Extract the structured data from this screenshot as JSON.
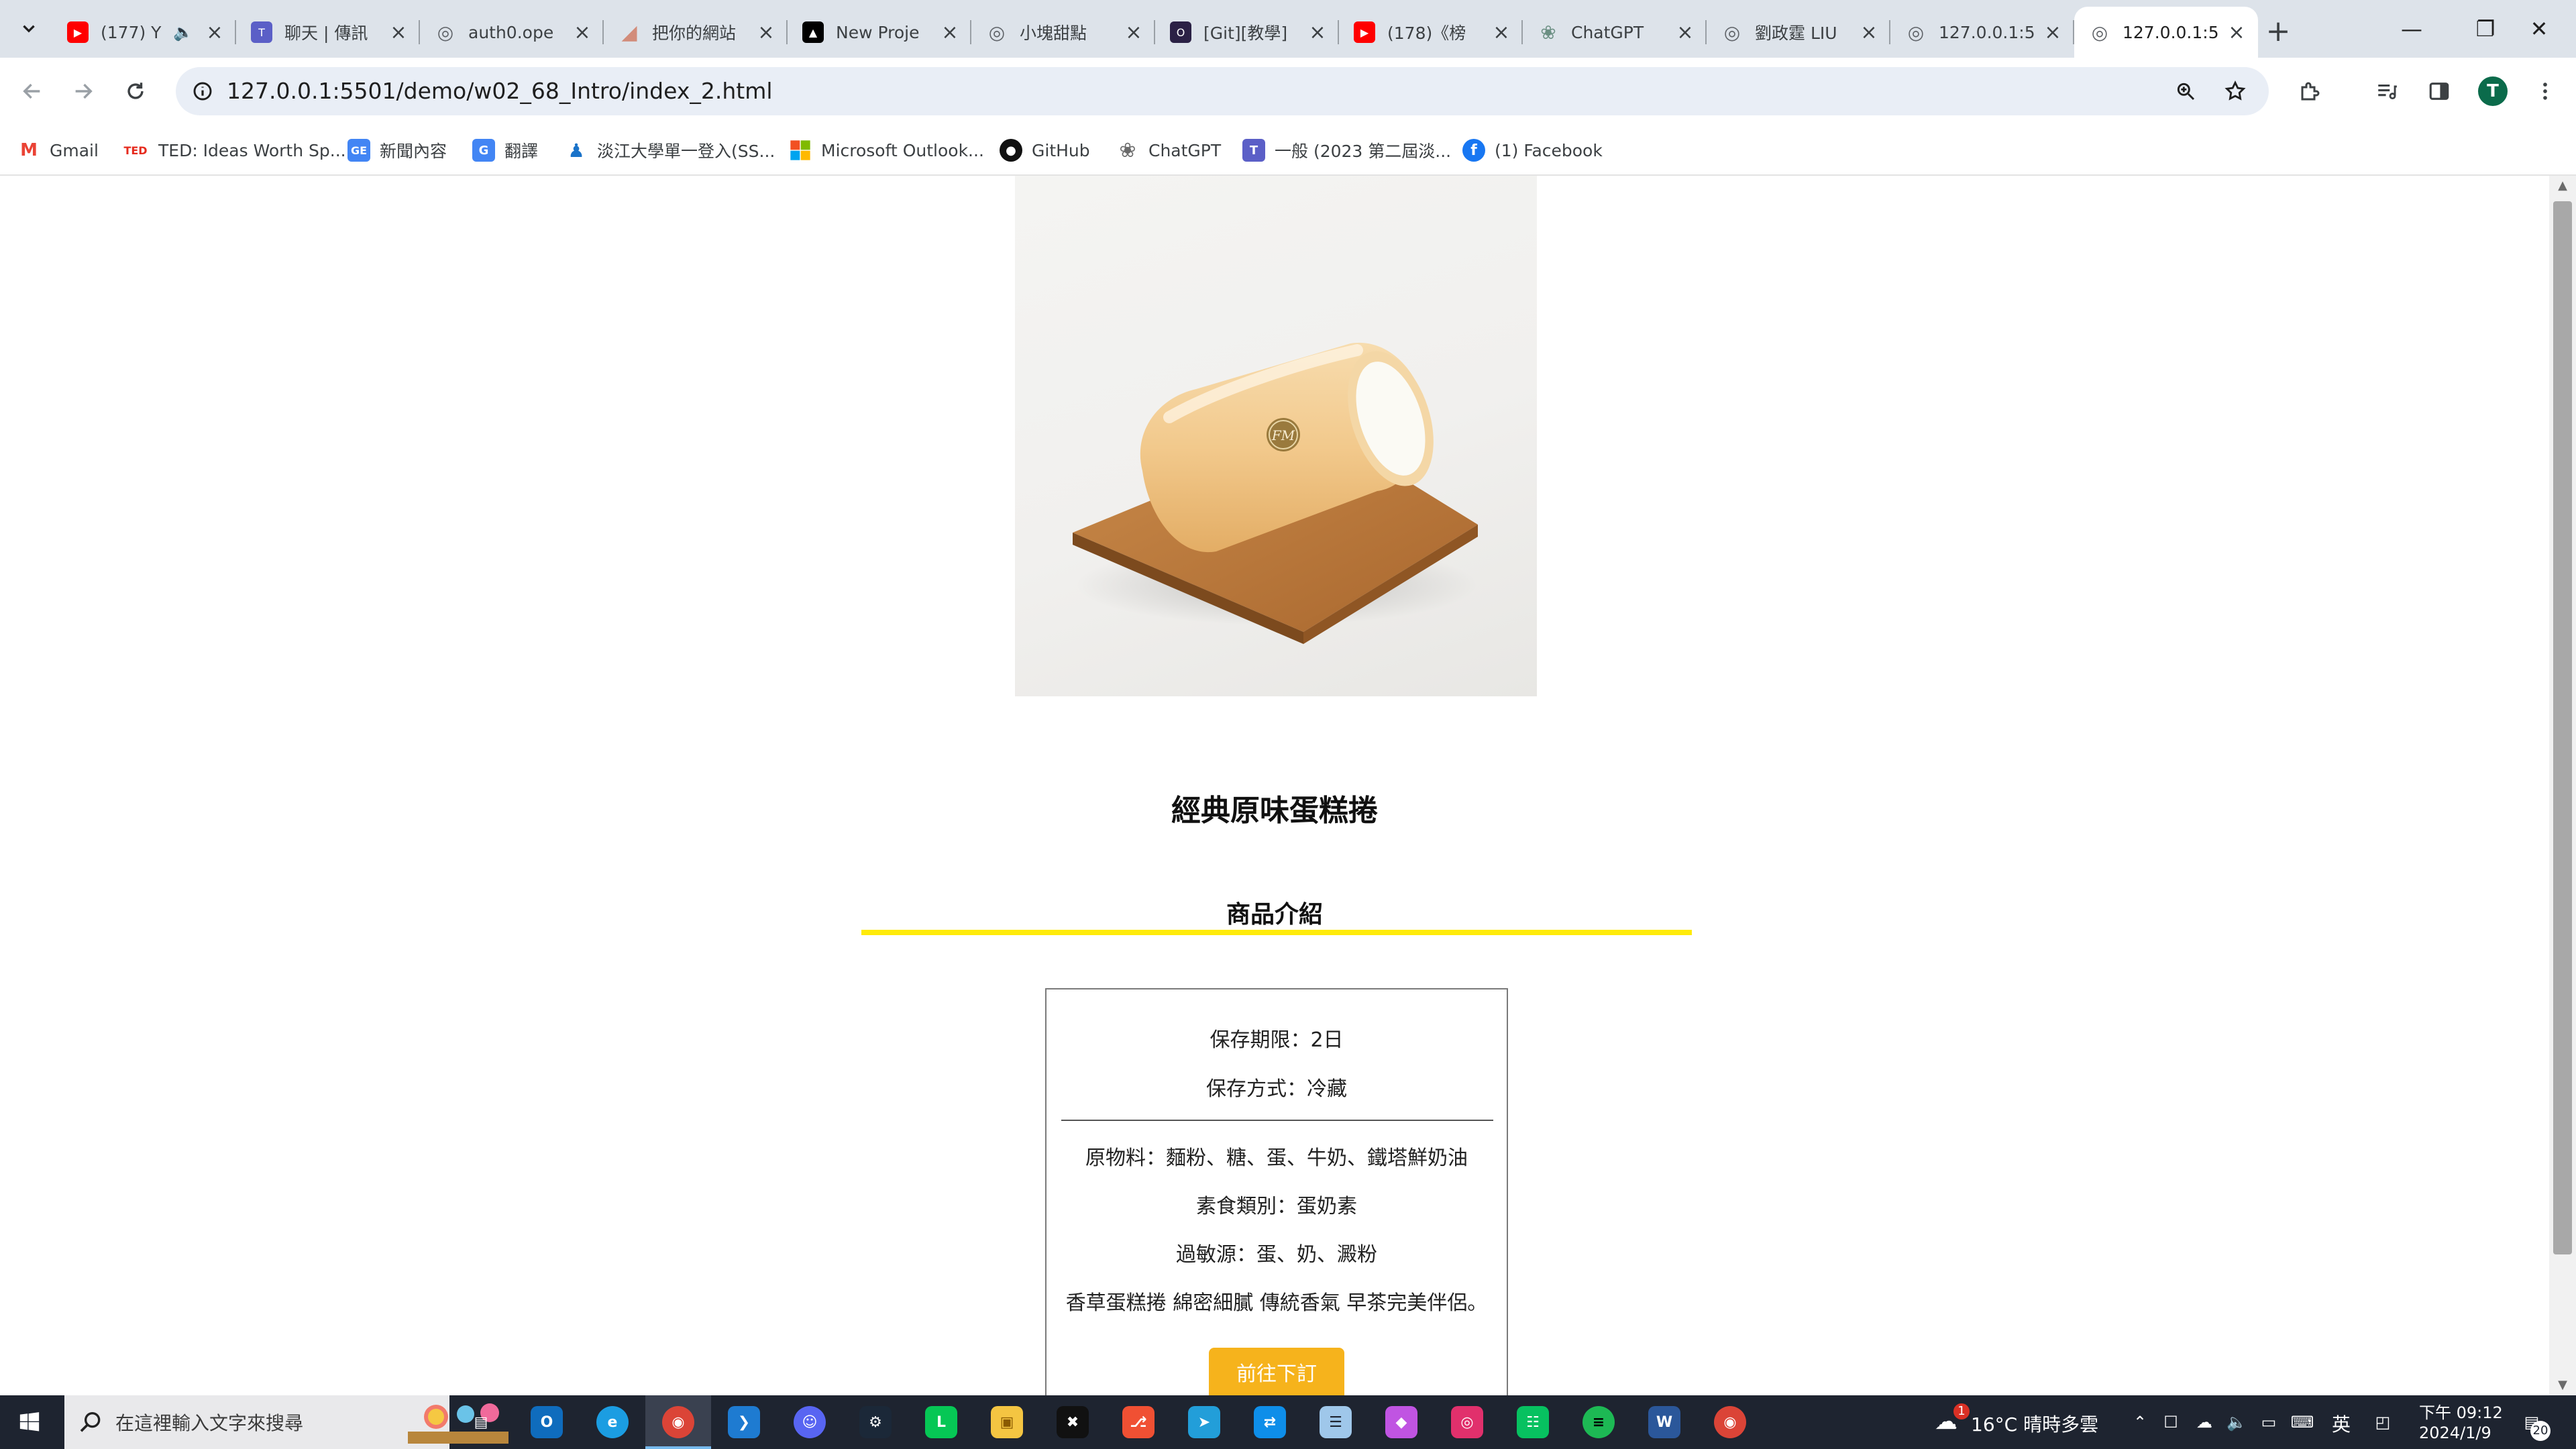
{
  "tabs": [
    {
      "title": "(177) Y",
      "favicon": "youtube-icon",
      "muted_icon": "speaker-icon"
    },
    {
      "title": "聊天 | 傳訊",
      "favicon": "teams-icon"
    },
    {
      "title": "auth0.ope",
      "favicon": "globe-icon"
    },
    {
      "title": "把你的網站",
      "favicon": "triangle-icon"
    },
    {
      "title": "New Proje",
      "favicon": "vercel-icon"
    },
    {
      "title": "小塊甜點",
      "favicon": "globe-icon"
    },
    {
      "title": "[Git][教學]",
      "favicon": "blog-icon"
    },
    {
      "title": "(178)《榜",
      "favicon": "youtube-icon"
    },
    {
      "title": "ChatGPT",
      "favicon": "openai-icon"
    },
    {
      "title": "劉政霆 LIU",
      "favicon": "globe-icon"
    },
    {
      "title": "127.0.0.1:5",
      "favicon": "globe-icon"
    },
    {
      "title": "127.0.0.1:5",
      "favicon": "globe-icon",
      "active": true
    }
  ],
  "toolbar": {
    "url": "127.0.0.1:5501/demo/w02_68_Intro/index_2.html",
    "profile_initial": "T"
  },
  "bookmarks": [
    {
      "label": "Gmail",
      "icon": "gmail-icon"
    },
    {
      "label": "TED: Ideas Worth Sp...",
      "icon": "ted-icon"
    },
    {
      "label": "新聞內容",
      "icon": "news-icon"
    },
    {
      "label": "翻譯",
      "icon": "translate-icon"
    },
    {
      "label": "淡江大學單一登入(SS...",
      "icon": "tku-icon"
    },
    {
      "label": "Microsoft Outlook...",
      "icon": "microsoft-icon"
    },
    {
      "label": "GitHub",
      "icon": "github-icon"
    },
    {
      "label": "ChatGPT",
      "icon": "openai-icon"
    },
    {
      "label": "一般 (2023 第二屆淡...",
      "icon": "teams-icon"
    },
    {
      "label": "(1) Facebook",
      "icon": "facebook-icon"
    }
  ],
  "page": {
    "image_logo_text": "FM",
    "product_title": "經典原味蛋糕捲",
    "section_heading": "商品介紹",
    "info": {
      "shelf_life": "保存期限：2日",
      "storage": "保存方式：冷藏",
      "ingredients": "原物料：麵粉、糖、蛋、牛奶、鐵塔鮮奶油",
      "vegetarian": "素食類別：蛋奶素",
      "allergens": "過敏源：蛋、奶、澱粉",
      "description": "香草蛋糕捲 綿密細膩 傳統香氣 早茶完美伴侶。"
    },
    "order_button": "前往下訂",
    "accent_color": "#ffeb0a",
    "button_color": "#f6b31c"
  },
  "taskbar": {
    "search_placeholder": "在這裡輸入文字來搜尋",
    "apps": [
      "task-view-icon",
      "outlook-icon",
      "edge-icon",
      "chrome-icon",
      "vscode-icon",
      "discord-icon",
      "steam-icon",
      "line-icon",
      "file-explorer-icon",
      "capcut-icon",
      "git-icon",
      "telegram-icon",
      "teamviewer-icon",
      "notepad-icon",
      "ink-icon",
      "instagram-icon",
      "wechat-icon",
      "spotify-icon",
      "word-icon",
      "chrome-icon"
    ],
    "weather": "16°C  晴時多雲",
    "weather_badge": "1",
    "ime": "英",
    "time": "下午 09:12",
    "date": "2024/1/9",
    "notifications": "20"
  }
}
